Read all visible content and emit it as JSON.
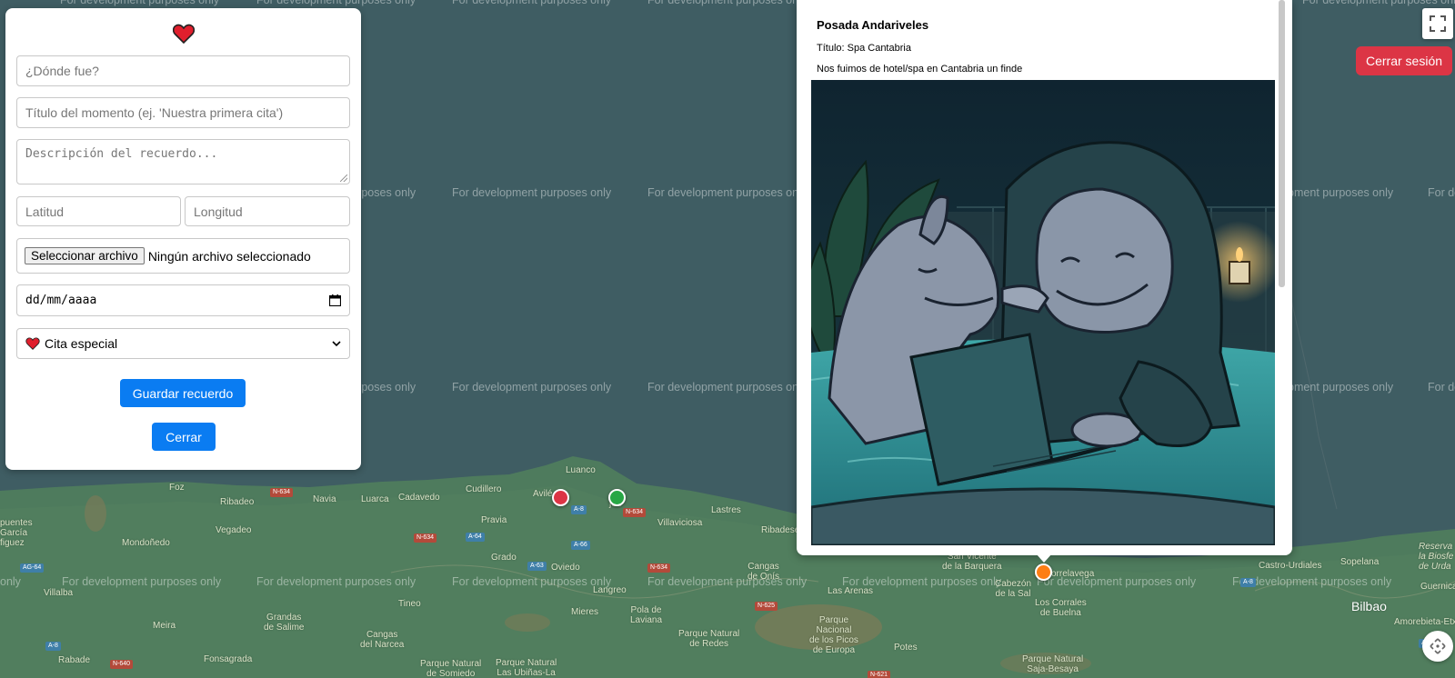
{
  "map": {
    "watermark": "For development purposes only",
    "places": {
      "luanco": "Luanco",
      "cudillero": "Cudillero",
      "aviles": "Avilé",
      "gijon": "jón",
      "foz": "Foz",
      "ribadeo": "Ribadeo",
      "navia": "Navia",
      "luarca": "Luarca",
      "cadavedo": "Cadavedo",
      "pravia": "Pravia",
      "villaviciosa": "Villaviciosa",
      "lastres": "Lastres",
      "ribadesella": "Ribadesella",
      "grado": "Grado",
      "oviedo": "Oviedo",
      "cangas_onis": "Cangas\nde Onís",
      "langreo": "Langreo",
      "tineo": "Tineo",
      "mondonedo": "Mondoñedo",
      "vegadeo": "Vegadeo",
      "pontes": "puentes\nGarcía\nfiguez",
      "villalba": "Villalba",
      "meira": "Meira",
      "grandas": "Grandas\nde Salime",
      "cangas_narcea": "Cangas\ndel Narcea",
      "rabade": "Rabade",
      "fonsagrada": "Fonsagrada",
      "pola_laviana": "Pola de\nLaviana",
      "mieres": "Mieres",
      "pn_redes": "Parque Natural\nde Redes",
      "pn_picos": "Parque\nNacional\nde los Picos\nde Europa",
      "pn_somiedo": "Parque Natural\nde Somiedo",
      "pn_ubinas": "Parque Natural\nLas Ubiñas-La",
      "las_arenas": "Las Arenas",
      "potes": "Potes",
      "san_vicente": "San Vicente\nde la Barquera",
      "cabezon": "Cabezón\nde la Sal",
      "torrelavega": "orrelavega",
      "los_corrales": "Los Corrales\nde Buelna",
      "pn_saja": "Parque Natural\nSaja-Besaya",
      "castro": "Castro-Urdiales",
      "sopelana": "Sopelana",
      "bilbao": "Bilbao",
      "amorebieta": "Amorebieta-Etxano",
      "reserva": "Reserva\nla Biosfe\nde Urda",
      "guernica": "Guernica y",
      "only_left": "only"
    },
    "roads": [
      "N-634",
      "N-634",
      "A-64",
      "N-634",
      "A-63",
      "A-66",
      "N-634",
      "N-625",
      "N-621",
      "AG-64",
      "A-8",
      "A-8",
      "N-640",
      "AP-68",
      "A-8"
    ],
    "pins": [
      {
        "color": "#dc3545"
      },
      {
        "color": "#28a745"
      },
      {
        "color": "#fd7e14"
      }
    ]
  },
  "controls": {
    "fullscreen_icon": "fullscreen-icon",
    "recenter_icon": "move-icon",
    "logout_label": "Cerrar sesión"
  },
  "form": {
    "heart_icon": "heart-icon",
    "place_placeholder": "¿Dónde fue?",
    "title_placeholder": "Título del momento (ej. 'Nuestra primera cita')",
    "description_placeholder": "Descripción del recuerdo...",
    "lat_placeholder": "Latitud",
    "lng_placeholder": "Longitud",
    "file_button": "Seleccionar archivo",
    "file_status": "Ningún archivo seleccionado",
    "date_placeholder": "dd/mm/aaaa",
    "type_selected": "Cita especial",
    "save_label": "Guardar recuerdo",
    "close_label": "Cerrar"
  },
  "popup": {
    "title": "Posada Andariveles",
    "subtitle": "Título: Spa Cantabria",
    "description": "Nos fuimos de hotel/spa en Cantabria un finde",
    "photo_alt": "two-dolphins-in-hot-tub-with-laptop"
  },
  "colors": {
    "accent_blue": "#0a7cf2",
    "danger_red": "#dc3545",
    "sea": "#3f5d63",
    "land": "#4d7a5e"
  }
}
